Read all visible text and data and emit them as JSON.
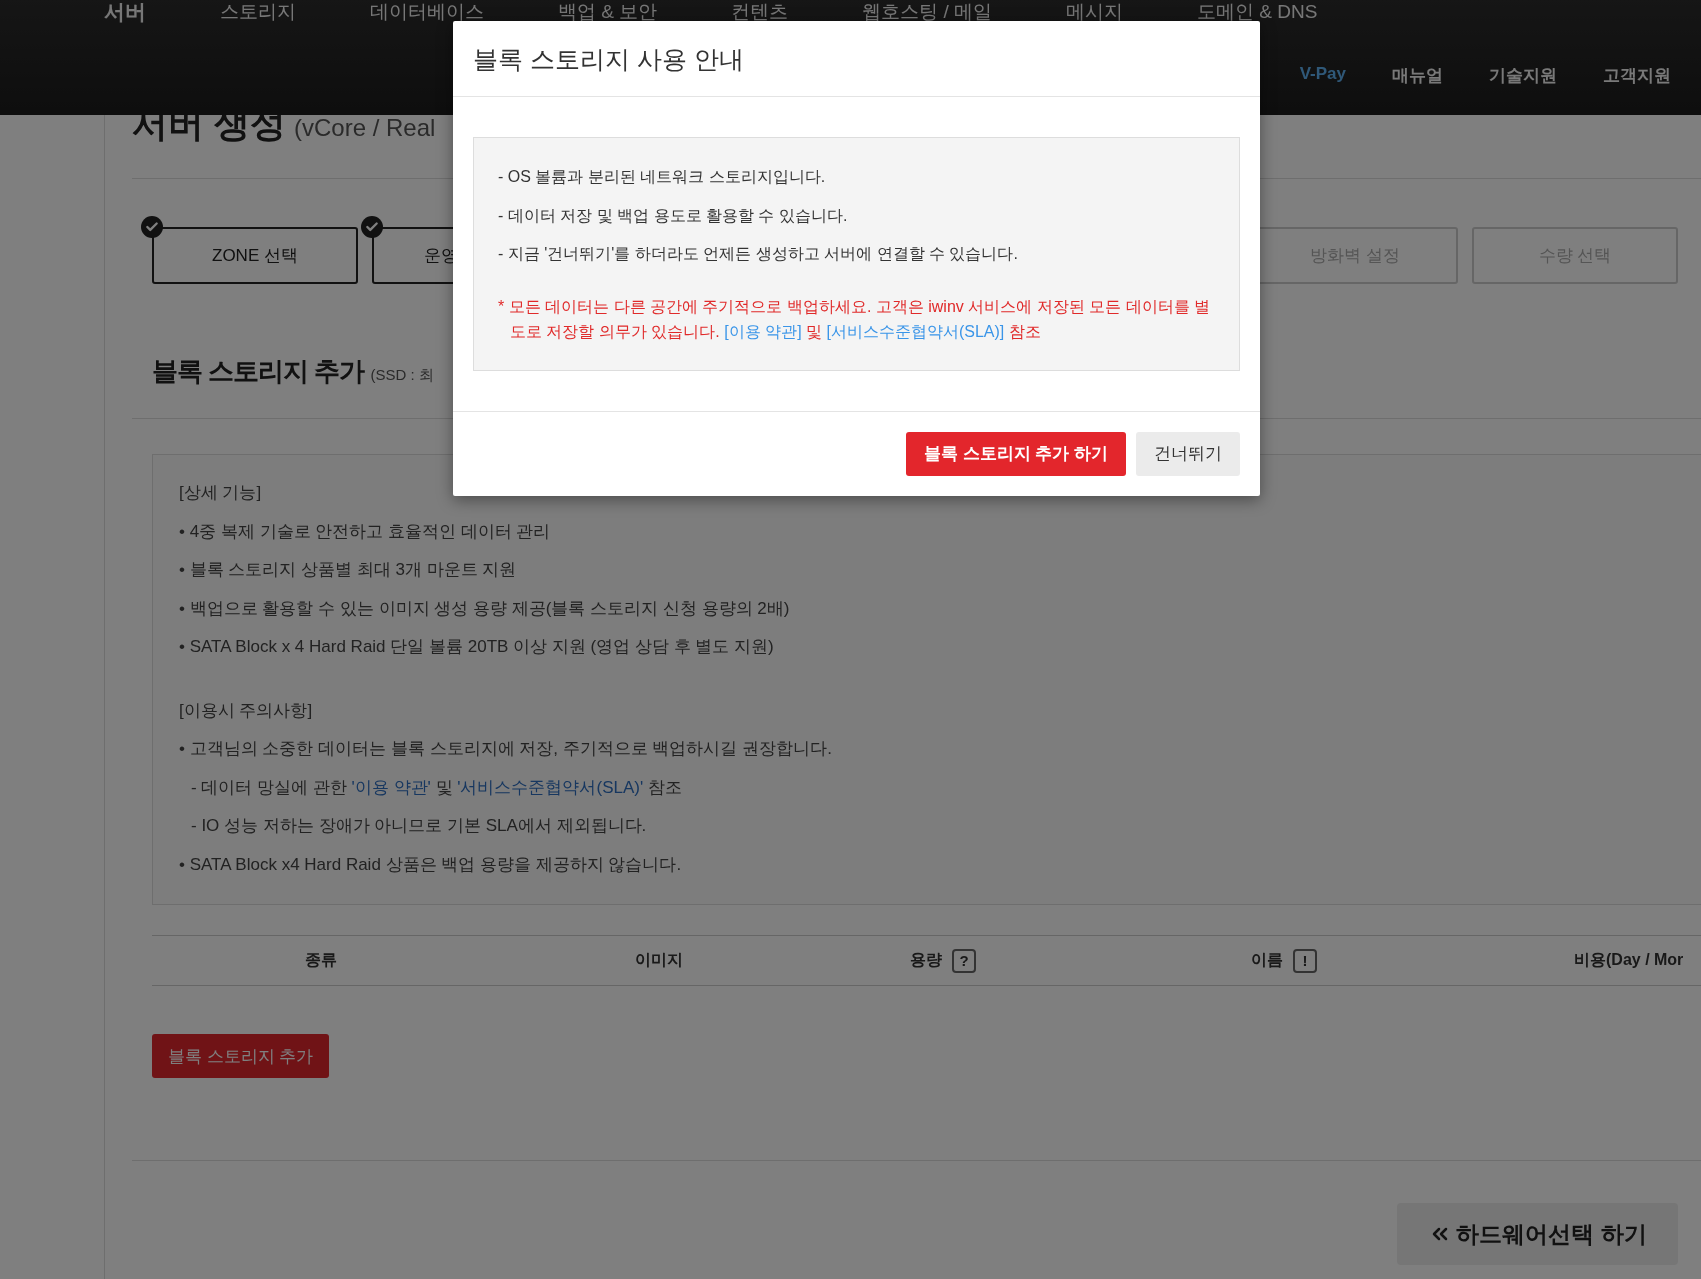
{
  "top_nav": {
    "menu": [
      "서버",
      "스토리지",
      "데이터베이스",
      "백업 & 보안",
      "컨텐츠",
      "웹호스팅 / 메일",
      "메시지",
      "도메인 & DNS"
    ],
    "utility": [
      {
        "label": "V-Pay",
        "highlighted": true
      },
      {
        "label": "매뉴얼",
        "highlighted": false
      },
      {
        "label": "기술지원",
        "highlighted": false
      },
      {
        "label": "고객지원",
        "highlighted": false
      }
    ]
  },
  "page": {
    "title": "서버 생성",
    "subtitle": "(vCore / Real",
    "steps_left": [
      {
        "label": "ZONE 선택",
        "done": true,
        "clipped": false
      },
      {
        "label": "운영",
        "done": true,
        "clipped": true
      }
    ],
    "steps_right": [
      {
        "label": "방화벽 설정",
        "done": false,
        "clipped": false
      },
      {
        "label": "수량 선택",
        "done": false,
        "clipped": false
      }
    ],
    "section_title": "블록 스토리지 추가",
    "section_note": "(SSD : 최",
    "info_sections": [
      {
        "heading": "[상세 기능]",
        "lines": [
          {
            "kind": "bullet",
            "parts": [
              {
                "text": "• 4중 복제 기술로 안전하고 효율적인 데이터 관리",
                "kind": "text"
              }
            ]
          },
          {
            "kind": "bullet",
            "parts": [
              {
                "text": "• 블록 스토리지 상품별 최대 3개 마운트 지원",
                "kind": "text"
              }
            ]
          },
          {
            "kind": "bullet",
            "parts": [
              {
                "text": "• 백업으로 활용할 수 있는 이미지 생성 용량 제공(블록 스토리지 신청 용량의 2배)",
                "kind": "text"
              }
            ]
          },
          {
            "kind": "bullet",
            "parts": [
              {
                "text": "• SATA Block x 4 Hard Raid 단일 볼륨 20TB 이상 지원 (영업 상담 후 별도 지원)",
                "kind": "text"
              }
            ]
          }
        ]
      },
      {
        "heading": "[이용시 주의사항]",
        "lines": [
          {
            "kind": "bullet",
            "parts": [
              {
                "text": "• 고객님의 소중한 데이터는 블록 스토리지에 저장, 주기적으로 백업하시길 권장합니다.",
                "kind": "text"
              }
            ]
          },
          {
            "kind": "sub",
            "parts": [
              {
                "text": "- 데이터 망실에 관한 ",
                "kind": "text"
              },
              {
                "text": "'이용 약관'",
                "kind": "link"
              },
              {
                "text": " 및 ",
                "kind": "text"
              },
              {
                "text": "'서비스수준협약서(SLA)'",
                "kind": "link"
              },
              {
                "text": " 참조",
                "kind": "text"
              }
            ]
          },
          {
            "kind": "sub",
            "parts": [
              {
                "text": "- IO 성능 저하는 장애가 아니므로 기본 SLA에서 제외됩니다.",
                "kind": "text"
              }
            ]
          },
          {
            "kind": "bullet",
            "parts": [
              {
                "text": "• SATA Block x4 Hard Raid 상품은 백업 용량을 제공하지 않습니다.",
                "kind": "text"
              }
            ]
          }
        ]
      }
    ],
    "table": {
      "columns": [
        {
          "label": "종류"
        },
        {
          "label": "이미지"
        },
        {
          "label": "용량",
          "badge": "?"
        },
        {
          "label": "이름",
          "badge": "!"
        },
        {
          "label": "비용(Day / Mor"
        }
      ]
    },
    "add_button": "블록 스토리지 추가",
    "back_button": "하드웨어선택 하기"
  },
  "modal": {
    "title": "블록 스토리지 사용 안내",
    "lines": [
      "- OS 볼륨과 분리된 네트워크 스토리지입니다.",
      "- 데이터 저장 및 백업 용도로 활용할 수 있습니다.",
      "- 지금 '건너뛰기'를 하더라도 언제든 생성하고 서버에 연결할 수 있습니다."
    ],
    "notice": [
      {
        "text": "* 모든 데이터는 다른 공간에 주기적으로 백업하세요. 고객은 iwinv 서비스에 저장된 모든 데이터를 별도로 저장할 의무가 있습니다. ",
        "kind": "text"
      },
      {
        "text": "[이용 약관]",
        "kind": "link"
      },
      {
        "text": " 및 ",
        "kind": "text"
      },
      {
        "text": "[서비스수준협약서(SLA)]",
        "kind": "link"
      },
      {
        "text": " 참조",
        "kind": "text"
      }
    ],
    "buttons": [
      {
        "label": "블록 스토리지 추가 하기",
        "kind": "primary"
      },
      {
        "label": "건너뛰기",
        "kind": "secondary"
      }
    ]
  }
}
